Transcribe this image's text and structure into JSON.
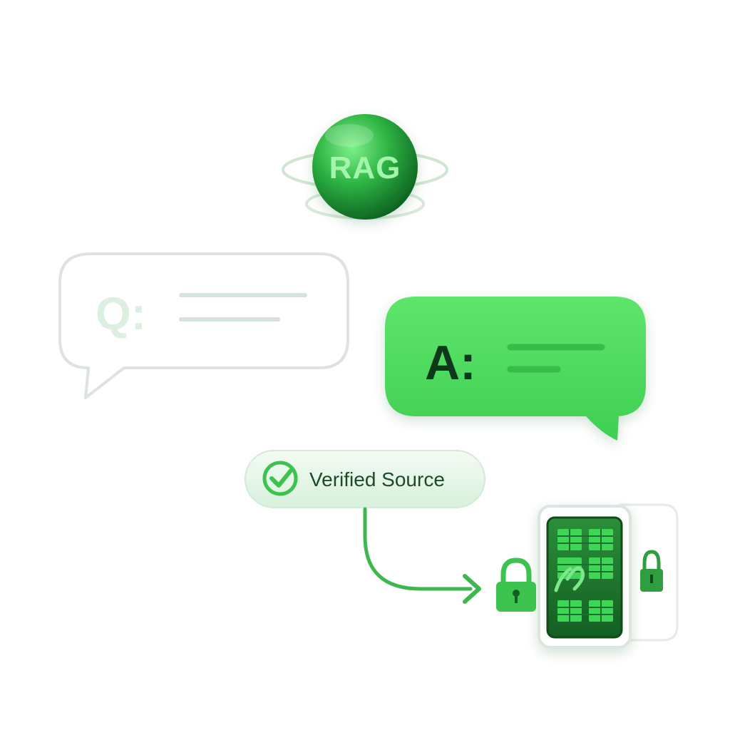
{
  "rag_orb": {
    "label": "RAG",
    "colors": {
      "sphere_light": "#6dee7c",
      "sphere_dark": "#0f6b24",
      "text": "#9ff5a8",
      "ring": "#cfe6d2"
    }
  },
  "question_bubble": {
    "label": "Q:",
    "colors": {
      "border": "#dbe3dc",
      "label": "#dcefe0",
      "lines": "#d6e3d8"
    }
  },
  "answer_bubble": {
    "label": "A:",
    "colors": {
      "fill": "#4fdc5f",
      "label": "#0f3a17",
      "lines": "#37c049"
    }
  },
  "verified_badge": {
    "label": "Verified Source",
    "icon": "check-circle-icon",
    "colors": {
      "fill": "#e6f6e8",
      "text": "#1e4a25",
      "check": "#3ec24f"
    }
  },
  "arrow": {
    "icon": "arrow-right-icon",
    "color": "#3eb74f"
  },
  "vault": {
    "icons": [
      "padlock-icon",
      "database-table-icon",
      "link-icon"
    ],
    "colors": {
      "frame": "#dfe8e0",
      "screen": "#1d7a2e",
      "cells": "#3fd556",
      "lock": "#3cc24f"
    }
  }
}
